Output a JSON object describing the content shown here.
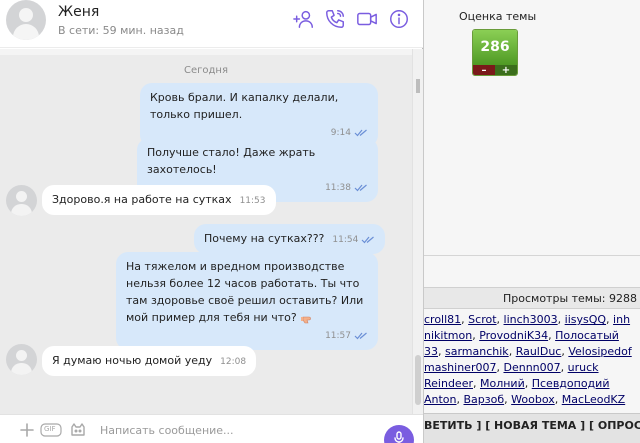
{
  "chat": {
    "contact_name": "Женя",
    "contact_status": "В сети: 59 мин. назад",
    "date_separator": "Сегодня",
    "icons": [
      "add-contact-icon",
      "phone-call-icon",
      "video-call-icon",
      "info-icon"
    ],
    "messages": [
      {
        "direction": "out",
        "text": "Кровь брали. И капалку делали, только пришел.",
        "time": "9:14",
        "read": true
      },
      {
        "direction": "out",
        "text": "Получше стало! Даже жрать захотелось!",
        "time": "11:38",
        "read": true
      },
      {
        "direction": "in",
        "text": "Здорово.я на работе на сутках",
        "time": "11:53"
      },
      {
        "direction": "out",
        "text": "Почему на сутках???",
        "time": "11:54",
        "read": true
      },
      {
        "direction": "out",
        "text": "На тяжелом и вредном производстве нельзя более 12 часов работать. Ты что там здоровье своё решил оставить? Или мой пример для тебя ни что?",
        "emoji": "point-finger-icon",
        "time": "11:57",
        "read": true
      },
      {
        "direction": "in",
        "text": "Я думаю ночью домой уеду",
        "time": "12:08"
      }
    ],
    "composer": {
      "placeholder": "Написать сообщение...",
      "gif_label": "GIF",
      "icons": [
        "plus-icon",
        "gif-icon",
        "sticker-icon",
        "microphone-icon"
      ]
    }
  },
  "forum": {
    "rating_label": "Оценка темы",
    "rating_value": "286",
    "rating_minus": "–",
    "rating_plus": "+",
    "views_label": "Просмотры темы: 9288",
    "users_lines": [
      [
        "croll81",
        "Scrot",
        "linch3003",
        "iisysQQ",
        "inh"
      ],
      [
        "nikitmon",
        "ProvodniK34",
        "Полосатый"
      ],
      [
        "33",
        "sarmanchik",
        "RaulDuc",
        "Velosipedof"
      ],
      [
        "mashiner007",
        "Dennn007",
        "uruck"
      ],
      [
        "Reindeer",
        "Молний",
        "Псевдоподий"
      ],
      [
        "Anton",
        "Варзоб",
        "Woobox",
        "MacLeodKZ"
      ]
    ],
    "actions": [
      "ВЕТИТЬ ]",
      "[ НОВАЯ ТЕМА ]",
      "[ ОПРОС ]"
    ]
  },
  "colors": {
    "outgoing_bubble": "#d7e8fa",
    "incoming_bubble": "#ffffff",
    "accent_purple": "#7a5de0",
    "read_ticks": "#6b8fd6",
    "rating_green": "#5aa82b"
  }
}
